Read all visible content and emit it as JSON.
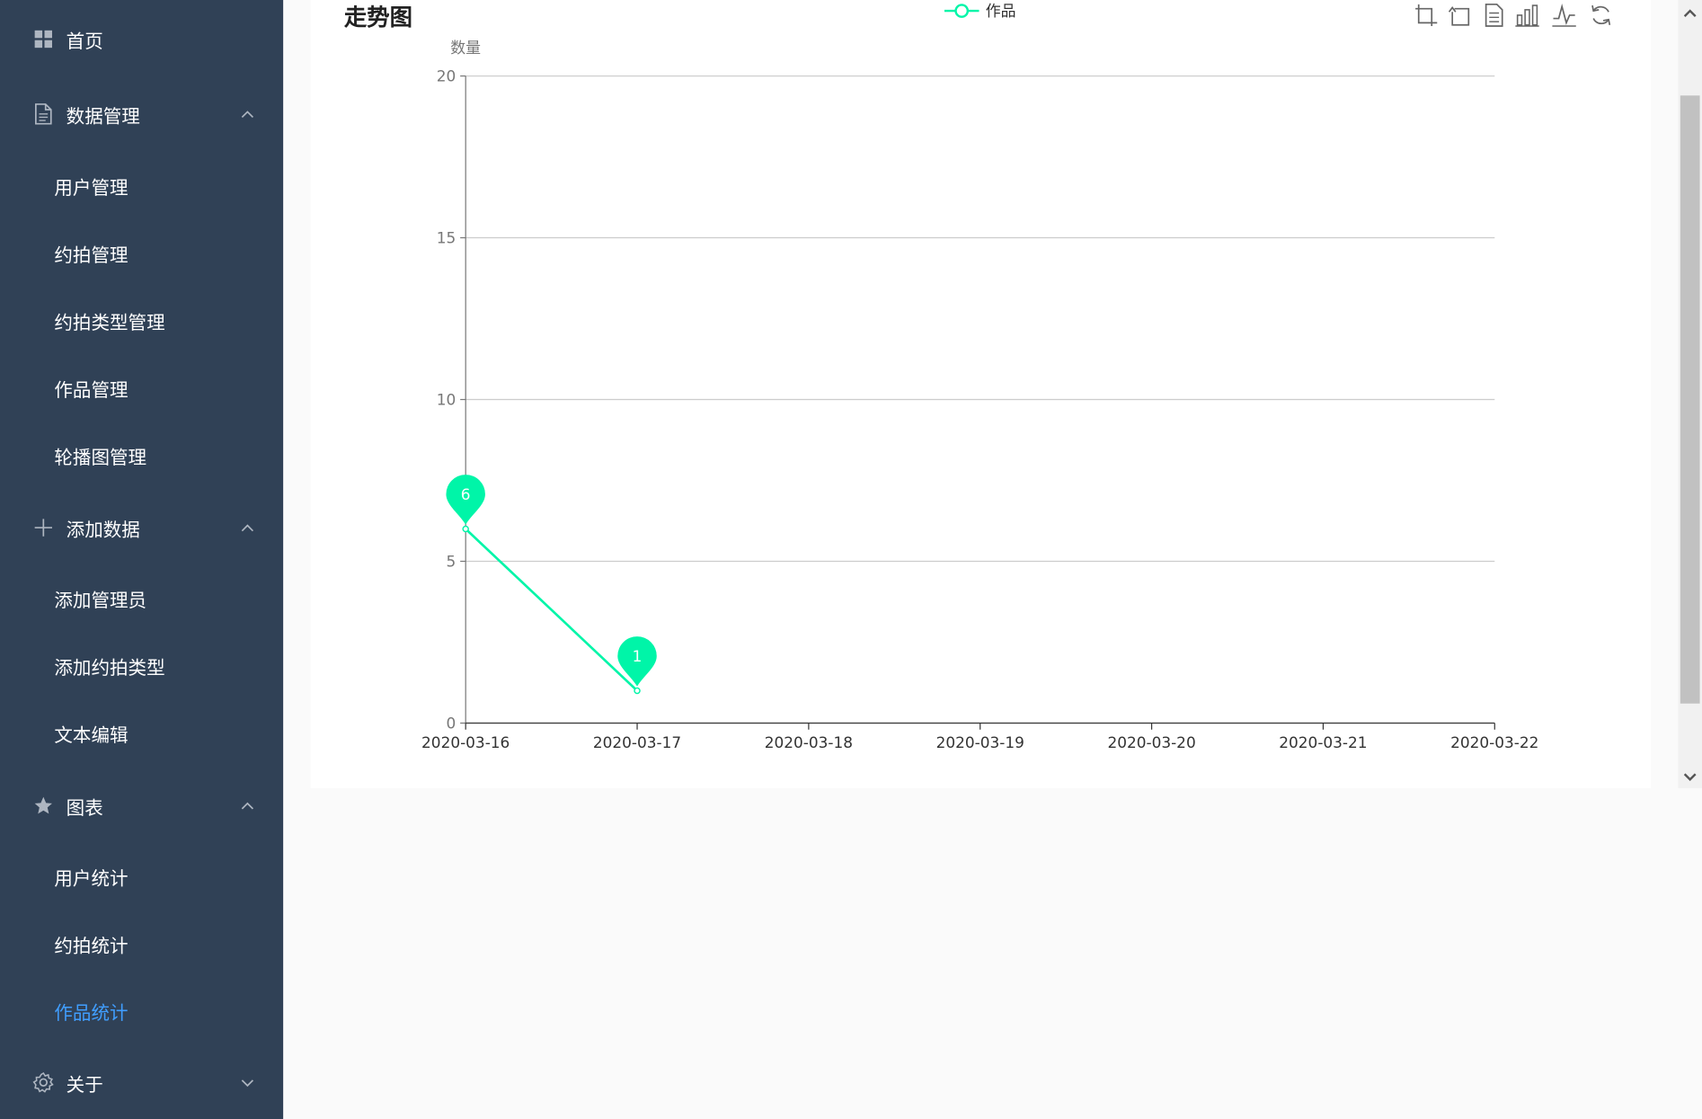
{
  "colors": {
    "sidebar_bg": "#304156",
    "sidebar_text": "#ffffff",
    "active_text": "#409eff",
    "series_color": "#00f5a8",
    "axis": "#333333",
    "grid": "#cccccc"
  },
  "sidebar": {
    "items": [
      {
        "label": "首页",
        "icon": "grid-icon"
      },
      {
        "label": "数据管理",
        "icon": "document-icon",
        "expanded": true,
        "children": [
          {
            "label": "用户管理"
          },
          {
            "label": "约拍管理"
          },
          {
            "label": "约拍类型管理"
          },
          {
            "label": "作品管理"
          },
          {
            "label": "轮播图管理"
          }
        ]
      },
      {
        "label": "添加数据",
        "icon": "plus-icon",
        "expanded": true,
        "children": [
          {
            "label": "添加管理员"
          },
          {
            "label": "添加约拍类型"
          },
          {
            "label": "文本编辑"
          }
        ]
      },
      {
        "label": "图表",
        "icon": "star-icon",
        "expanded": true,
        "children": [
          {
            "label": "用户统计"
          },
          {
            "label": "约拍统计"
          },
          {
            "label": "作品统计",
            "active": true
          }
        ]
      },
      {
        "label": "关于",
        "icon": "gear-icon",
        "expanded": false
      }
    ]
  },
  "toolbox": {
    "icons": [
      "zoom-area-icon",
      "zoom-reset-icon",
      "data-view-icon",
      "bar-chart-icon",
      "line-chart-icon",
      "restore-icon"
    ]
  },
  "chart_data": {
    "type": "line",
    "title": "走势图",
    "ylabel": "数量",
    "xlabel": "",
    "legend": {
      "entries": [
        "作品"
      ],
      "placement": "top-center"
    },
    "x": [
      "2020-03-16",
      "2020-03-17",
      "2020-03-18",
      "2020-03-19",
      "2020-03-20",
      "2020-03-21",
      "2020-03-22"
    ],
    "series": [
      {
        "name": "作品",
        "values": [
          6,
          1
        ],
        "color": "#00f5a8"
      }
    ],
    "markers": [
      {
        "x": "2020-03-16",
        "value": 6,
        "label": "6"
      },
      {
        "x": "2020-03-17",
        "value": 1,
        "label": "1"
      }
    ],
    "ylim": [
      0,
      20
    ],
    "yticks": [
      0,
      5,
      10,
      15,
      20
    ],
    "grid": true
  }
}
